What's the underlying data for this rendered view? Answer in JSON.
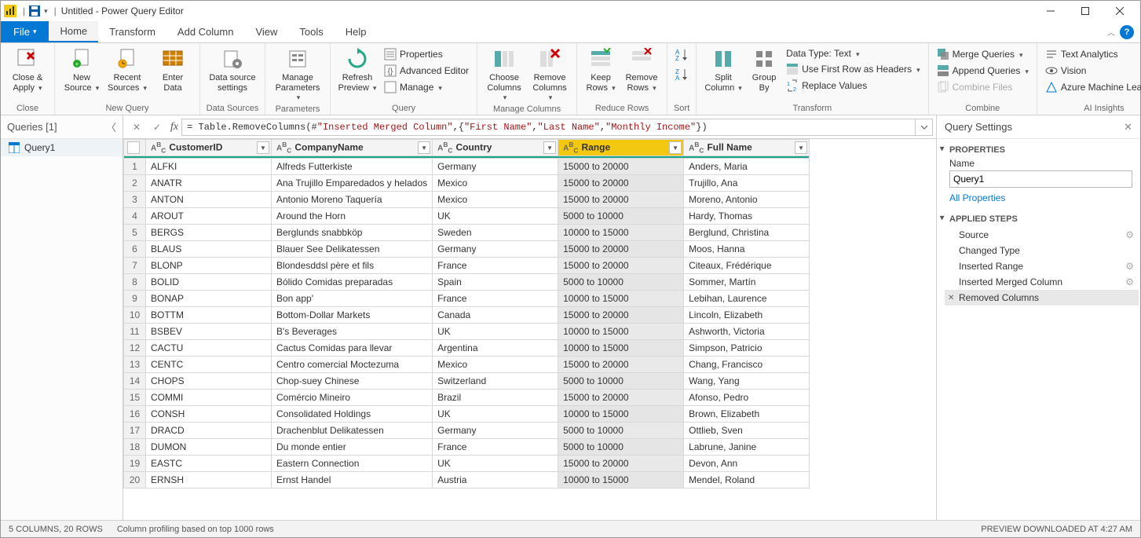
{
  "window": {
    "title": "Untitled - Power Query Editor"
  },
  "ribbon": {
    "file": "File",
    "home": "Home",
    "transform": "Transform",
    "addColumn": "Add Column",
    "view": "View",
    "tools": "Tools",
    "help": "Help",
    "close": {
      "closeApply": "Close & Apply",
      "group": "Close"
    },
    "newQuery": {
      "newSource": "New Source",
      "recentSources": "Recent Sources",
      "enterData": "Enter Data",
      "group": "New Query"
    },
    "dataSources": {
      "dsSettings": "Data source settings",
      "group": "Data Sources"
    },
    "parameters": {
      "manageParams": "Manage Parameters",
      "group": "Parameters"
    },
    "query": {
      "refreshPreview": "Refresh Preview",
      "properties": "Properties",
      "advancedEditor": "Advanced Editor",
      "manage": "Manage",
      "group": "Query"
    },
    "manageColumns": {
      "chooseColumns": "Choose Columns",
      "removeColumns": "Remove Columns",
      "group": "Manage Columns"
    },
    "reduceRows": {
      "keepRows": "Keep Rows",
      "removeRows": "Remove Rows",
      "group": "Reduce Rows"
    },
    "sort": {
      "group": "Sort"
    },
    "transformGrp": {
      "splitColumn": "Split Column",
      "groupBy": "Group By",
      "dataType": "Data Type: Text",
      "firstRowHeaders": "Use First Row as Headers",
      "replaceValues": "Replace Values",
      "group": "Transform"
    },
    "combine": {
      "mergeQueries": "Merge Queries",
      "appendQueries": "Append Queries",
      "combineFiles": "Combine Files",
      "group": "Combine"
    },
    "aiInsights": {
      "textAnalytics": "Text Analytics",
      "vision": "Vision",
      "aml": "Azure Machine Learning",
      "group": "AI Insights"
    }
  },
  "queriesPanel": {
    "title": "Queries [1]",
    "items": [
      "Query1"
    ]
  },
  "formula": {
    "prefix": "= Table.RemoveColumns(#",
    "ref": "\"Inserted Merged Column\"",
    "mid": ",{",
    "c1": "\"First Name\"",
    "sep": ", ",
    "c2": "\"Last Name\"",
    "c3": "\"Monthly Income\"",
    "suffix": "})"
  },
  "columns": [
    {
      "name": "CustomerID",
      "selected": false
    },
    {
      "name": "CompanyName",
      "selected": false
    },
    {
      "name": "Country",
      "selected": false
    },
    {
      "name": "Range",
      "selected": true
    },
    {
      "name": "Full Name",
      "selected": false
    }
  ],
  "rows": [
    [
      "ALFKI",
      "Alfreds Futterkiste",
      "Germany",
      "15000 to 20000",
      "Anders, Maria"
    ],
    [
      "ANATR",
      "Ana Trujillo Emparedados y helados",
      "Mexico",
      "15000 to 20000",
      "Trujillo, Ana"
    ],
    [
      "ANTON",
      "Antonio Moreno Taquería",
      "Mexico",
      "15000 to 20000",
      "Moreno, Antonio"
    ],
    [
      "AROUT",
      "Around the Horn",
      "UK",
      "5000 to 10000",
      "Hardy, Thomas"
    ],
    [
      "BERGS",
      "Berglunds snabbköp",
      "Sweden",
      "10000 to 15000",
      "Berglund, Christina"
    ],
    [
      "BLAUS",
      "Blauer See Delikatessen",
      "Germany",
      "15000 to 20000",
      "Moos, Hanna"
    ],
    [
      "BLONP",
      "Blondesddsl père et fils",
      "France",
      "15000 to 20000",
      "Citeaux, Frédérique"
    ],
    [
      "BOLID",
      "Bólido Comidas preparadas",
      "Spain",
      "5000 to 10000",
      "Sommer, Martín"
    ],
    [
      "BONAP",
      "Bon app'",
      "France",
      "10000 to 15000",
      "Lebihan, Laurence"
    ],
    [
      "BOTTM",
      "Bottom-Dollar Markets",
      "Canada",
      "15000 to 20000",
      "Lincoln, Elizabeth"
    ],
    [
      "BSBEV",
      "B's Beverages",
      "UK",
      "10000 to 15000",
      "Ashworth, Victoria"
    ],
    [
      "CACTU",
      "Cactus Comidas para llevar",
      "Argentina",
      "10000 to 15000",
      "Simpson, Patricio"
    ],
    [
      "CENTC",
      "Centro comercial Moctezuma",
      "Mexico",
      "15000 to 20000",
      "Chang, Francisco"
    ],
    [
      "CHOPS",
      "Chop-suey Chinese",
      "Switzerland",
      "5000 to 10000",
      "Wang, Yang"
    ],
    [
      "COMMI",
      "Comércio Mineiro",
      "Brazil",
      "15000 to 20000",
      "Afonso, Pedro"
    ],
    [
      "CONSH",
      "Consolidated Holdings",
      "UK",
      "10000 to 15000",
      "Brown, Elizabeth"
    ],
    [
      "DRACD",
      "Drachenblut Delikatessen",
      "Germany",
      "5000 to 10000",
      "Ottlieb, Sven"
    ],
    [
      "DUMON",
      "Du monde entier",
      "France",
      "5000 to 10000",
      "Labrune, Janine"
    ],
    [
      "EASTC",
      "Eastern Connection",
      "UK",
      "15000 to 20000",
      "Devon, Ann"
    ],
    [
      "ERNSH",
      "Ernst Handel",
      "Austria",
      "10000 to 15000",
      "Mendel, Roland"
    ]
  ],
  "settings": {
    "title": "Query Settings",
    "propsHeader": "PROPERTIES",
    "nameLabel": "Name",
    "nameValue": "Query1",
    "allProps": "All Properties",
    "stepsHeader": "APPLIED STEPS",
    "steps": [
      {
        "name": "Source",
        "gear": true,
        "selected": false
      },
      {
        "name": "Changed Type",
        "gear": false,
        "selected": false
      },
      {
        "name": "Inserted Range",
        "gear": true,
        "selected": false
      },
      {
        "name": "Inserted Merged Column",
        "gear": true,
        "selected": false
      },
      {
        "name": "Removed Columns",
        "gear": false,
        "selected": true
      }
    ]
  },
  "status": {
    "cols": "5 COLUMNS, 20 ROWS",
    "profiling": "Column profiling based on top 1000 rows",
    "preview": "PREVIEW DOWNLOADED AT 4:27 AM"
  }
}
